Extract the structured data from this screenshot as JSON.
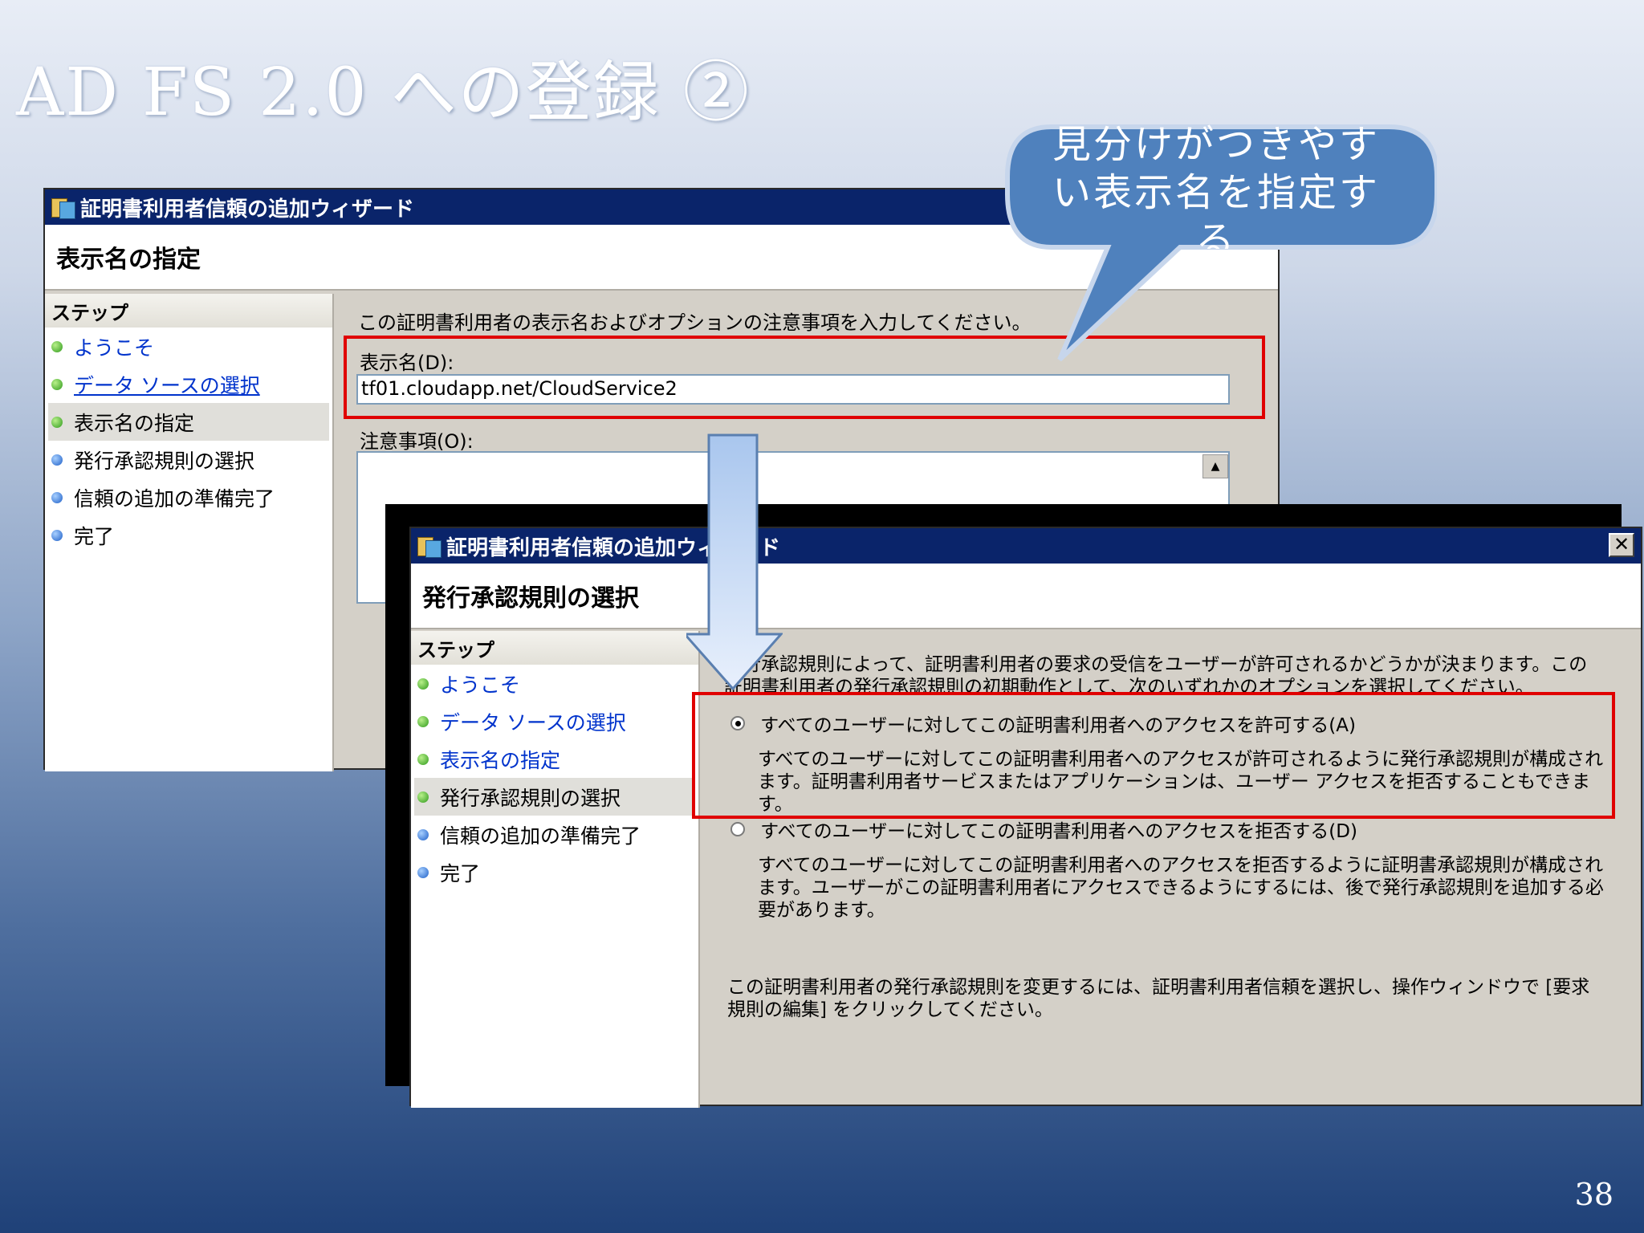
{
  "slide": {
    "title": "AD FS 2.0 への登録 ②",
    "page_number": "38"
  },
  "callout": {
    "text": "見分けがつきやすい表示名を指定する"
  },
  "wizard_back": {
    "title": "証明書利用者信頼の追加ウィザード",
    "header": "表示名の指定",
    "steps_heading": "ステップ",
    "steps": [
      "ようこそ",
      "データ ソースの選択",
      "表示名の指定",
      "発行承認規則の選択",
      "信頼の追加の準備完了",
      "完了"
    ],
    "instruction": "この証明書利用者の表示名およびオプションの注意事項を入力してください。",
    "display_name_label": "表示名(D):",
    "display_name_value": "tf01.cloudapp.net/CloudService2",
    "notes_label": "注意事項(O):"
  },
  "wizard_front": {
    "title": "証明書利用者信頼の追加ウィザード",
    "close": "✕",
    "header": "発行承認規則の選択",
    "steps_heading": "ステップ",
    "steps": [
      "ようこそ",
      "データ ソースの選択",
      "表示名の指定",
      "発行承認規則の選択",
      "信頼の追加の準備完了",
      "完了"
    ],
    "intro": "発行承認規則によって、証明書利用者の要求の受信をユーザーが許可されるかどうかが決まります。この証明書利用者の発行承認規則の初期動作として、次のいずれかのオプションを選択してください。",
    "option_permit_label": "すべてのユーザーに対してこの証明書利用者へのアクセスを許可する(A)",
    "option_permit_desc": "すべてのユーザーに対してこの証明書利用者へのアクセスが許可されるように発行承認規則が構成されます。証明書利用者サービスまたはアプリケーションは、ユーザー アクセスを拒否することもできます。",
    "option_deny_label": "すべてのユーザーに対してこの証明書利用者へのアクセスを拒否する(D)",
    "option_deny_desc": "すべてのユーザーに対してこの証明書利用者へのアクセスを拒否するように証明書承認規則が構成されます。ユーザーがこの証明書利用者にアクセスできるようにするには、後で発行承認規則を追加する必要があります。",
    "footer_note": "この証明書利用者の発行承認規則を変更するには、証明書利用者信頼を選択し、操作ウィンドウで [要求規則の編集] をクリックしてください。"
  },
  "selected_option": "permit",
  "colors": {
    "titlebar": "#0a246a",
    "highlight": "#e00000",
    "callout": "#4f81bd"
  }
}
